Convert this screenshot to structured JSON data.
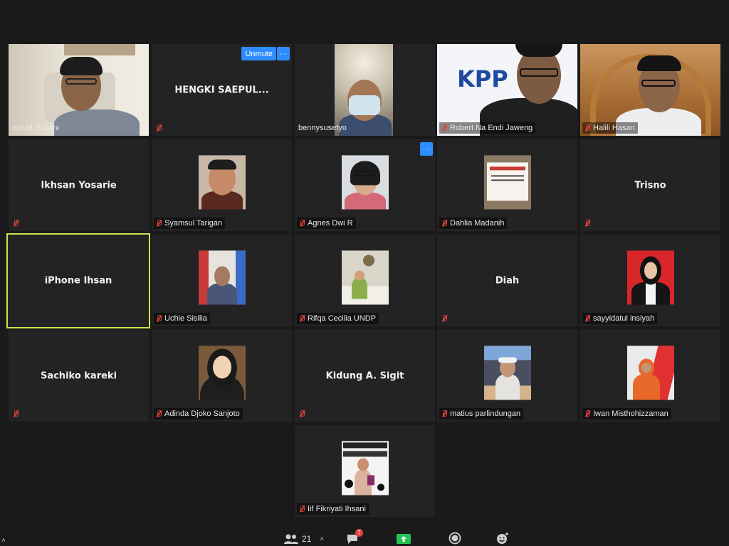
{
  "tiles": [
    {
      "name": "Ismail Hasani",
      "type": "video"
    },
    {
      "name": "HENGKI  SAEPUL...",
      "type": "name"
    },
    {
      "name": "bennysusetyo",
      "type": "video"
    },
    {
      "name": "Robert Na Endi Jaweng",
      "type": "video"
    },
    {
      "name": "Halili Hasan",
      "type": "video"
    },
    {
      "name": "Ikhsan Yosarie",
      "type": "name"
    },
    {
      "name": "Syamsul Tarigan",
      "type": "photo"
    },
    {
      "name": "Agnes Dwi R",
      "type": "photo"
    },
    {
      "name": "Dahlia Madanih",
      "type": "photo"
    },
    {
      "name": "Trisno",
      "type": "name"
    },
    {
      "name": "iPhone Ihsan",
      "type": "name"
    },
    {
      "name": "Uchie Sisilia",
      "type": "photo"
    },
    {
      "name": "Rifqa Cecilia UNDP",
      "type": "photo"
    },
    {
      "name": "Diah",
      "type": "name"
    },
    {
      "name": "sayyidatul insiyah",
      "type": "photo"
    },
    {
      "name": "Sachiko kareki",
      "type": "name"
    },
    {
      "name": "Adinda Djoko Sanjoto",
      "type": "photo"
    },
    {
      "name": "Kidung A. Sigit",
      "type": "name"
    },
    {
      "name": "matius parlindungan",
      "type": "photo"
    },
    {
      "name": "Iwan Misthohizzaman",
      "type": "photo"
    },
    {
      "name": "Iif Fikriyati Ihsani",
      "type": "photo"
    }
  ],
  "controls": {
    "unmute_label": "Unmute",
    "more_label": "···"
  },
  "robert_bg_text": "KPP",
  "toolbar": {
    "participants_count": "21",
    "chat_badge": "7"
  },
  "colors": {
    "accent": "#2d8cff",
    "active_border": "#cfe04a",
    "muted_icon": "#e0413b",
    "share_green": "#23c552"
  }
}
